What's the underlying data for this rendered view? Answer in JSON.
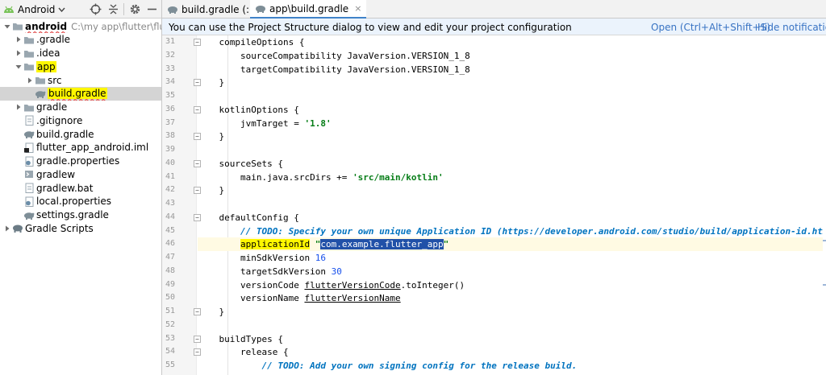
{
  "sidebar": {
    "view_selector": "Android",
    "tree": [
      {
        "label": "android",
        "path": "C:\\my app\\flutter\\flutter_a",
        "bold": true,
        "squiggle": true,
        "arrow": "down",
        "icon": "folder"
      },
      {
        "label": ".gradle",
        "arrow": "right",
        "icon": "folder"
      },
      {
        "label": ".idea",
        "arrow": "right",
        "icon": "folder"
      },
      {
        "label": "app",
        "arrow": "down",
        "icon": "folder",
        "highlight": true
      },
      {
        "label": "src",
        "arrow": "right",
        "icon": "folder"
      },
      {
        "label": "build.gradle",
        "icon": "gradle-file",
        "highlight": true,
        "squiggle": true,
        "selected": true
      },
      {
        "label": "gradle",
        "arrow": "right",
        "icon": "folder"
      },
      {
        "label": ".gitignore",
        "icon": "text-file"
      },
      {
        "label": "build.gradle",
        "icon": "gradle-file"
      },
      {
        "label": "flutter_app_android.iml",
        "icon": "iml-file"
      },
      {
        "label": "gradle.properties",
        "icon": "properties-file"
      },
      {
        "label": "gradlew",
        "icon": "script-file"
      },
      {
        "label": "gradlew.bat",
        "icon": "text-file"
      },
      {
        "label": "local.properties",
        "icon": "properties-file"
      },
      {
        "label": "settings.gradle",
        "icon": "gradle-file"
      },
      {
        "label": "Gradle Scripts",
        "arrow": "right",
        "icon": "gradle-elephant"
      }
    ]
  },
  "editor": {
    "tabs": [
      {
        "label": "build.gradle (:)",
        "active": false,
        "icon": "gradle-file"
      },
      {
        "label": "app\\build.gradle",
        "active": true,
        "icon": "gradle-file",
        "close": "×"
      }
    ],
    "notification": {
      "text": "You can use the Project Structure dialog to view and edit your project configuration",
      "open_link": "Open (Ctrl+Alt+Shift+S)",
      "hide_link": "Hide notification"
    },
    "current_line": 46,
    "lines": [
      {
        "no": "31",
        "segs": [
          [
            "    compileOptions {",
            ""
          ]
        ]
      },
      {
        "no": "32",
        "segs": [
          [
            "        sourceCompatibility JavaVersion.VERSION_1_8",
            ""
          ]
        ]
      },
      {
        "no": "33",
        "segs": [
          [
            "        targetCompatibility JavaVersion.VERSION_1_8",
            ""
          ]
        ]
      },
      {
        "no": "34",
        "segs": [
          [
            "    }",
            ""
          ]
        ]
      },
      {
        "no": "35",
        "segs": [
          [
            "",
            ""
          ]
        ]
      },
      {
        "no": "36",
        "segs": [
          [
            "    kotlinOptions {",
            ""
          ]
        ]
      },
      {
        "no": "37",
        "segs": [
          [
            "        jvmTarget = ",
            ""
          ],
          [
            "'1.8'",
            "s"
          ]
        ]
      },
      {
        "no": "38",
        "segs": [
          [
            "    }",
            ""
          ]
        ]
      },
      {
        "no": "39",
        "segs": [
          [
            "",
            ""
          ]
        ]
      },
      {
        "no": "40",
        "segs": [
          [
            "    sourceSets {",
            ""
          ]
        ]
      },
      {
        "no": "41",
        "segs": [
          [
            "        main.java.srcDirs += ",
            ""
          ],
          [
            "'src/main/kotlin'",
            "s"
          ]
        ]
      },
      {
        "no": "42",
        "segs": [
          [
            "    }",
            ""
          ]
        ]
      },
      {
        "no": "43",
        "segs": [
          [
            "",
            ""
          ]
        ]
      },
      {
        "no": "44",
        "segs": [
          [
            "    defaultConfig {",
            ""
          ]
        ]
      },
      {
        "no": "45",
        "segs": [
          [
            "        ",
            ""
          ],
          [
            "// TODO: Specify your own unique Application ID (https://developer.android.com/studio/build/application-id.html).",
            "t"
          ]
        ]
      },
      {
        "no": "46",
        "segs": [
          [
            "        ",
            ""
          ],
          [
            "applicationId",
            "hl"
          ],
          [
            " ",
            ""
          ],
          [
            "\"",
            "s"
          ],
          [
            "com.example.flutter_app",
            "sel"
          ],
          [
            "\"",
            "s"
          ]
        ]
      },
      {
        "no": "47",
        "segs": [
          [
            "        minSdkVersion ",
            ""
          ],
          [
            "16",
            "n"
          ]
        ]
      },
      {
        "no": "48",
        "segs": [
          [
            "        targetSdkVersion ",
            ""
          ],
          [
            "30",
            "n"
          ]
        ]
      },
      {
        "no": "49",
        "segs": [
          [
            "        versionCode ",
            ""
          ],
          [
            "flutterVersionCode",
            "u"
          ],
          [
            ".toInteger()",
            ""
          ]
        ]
      },
      {
        "no": "50",
        "segs": [
          [
            "        versionName ",
            ""
          ],
          [
            "flutterVersionName",
            "u"
          ]
        ]
      },
      {
        "no": "51",
        "segs": [
          [
            "    }",
            ""
          ]
        ]
      },
      {
        "no": "52",
        "segs": [
          [
            "",
            ""
          ]
        ]
      },
      {
        "no": "53",
        "segs": [
          [
            "    buildTypes {",
            ""
          ]
        ]
      },
      {
        "no": "54",
        "segs": [
          [
            "        release {",
            ""
          ]
        ]
      },
      {
        "no": "55",
        "segs": [
          [
            "            ",
            ""
          ],
          [
            "// TODO: Add your own signing config for the release build.",
            "t"
          ]
        ]
      }
    ],
    "fold_lines": [
      "31",
      "34",
      "36",
      "38",
      "40",
      "42",
      "44",
      "51",
      "53",
      "54"
    ]
  },
  "colors": {
    "accent": "#4083c9",
    "selection": "#2151a8",
    "highlight": "#fff700",
    "link": "#3873c3"
  }
}
